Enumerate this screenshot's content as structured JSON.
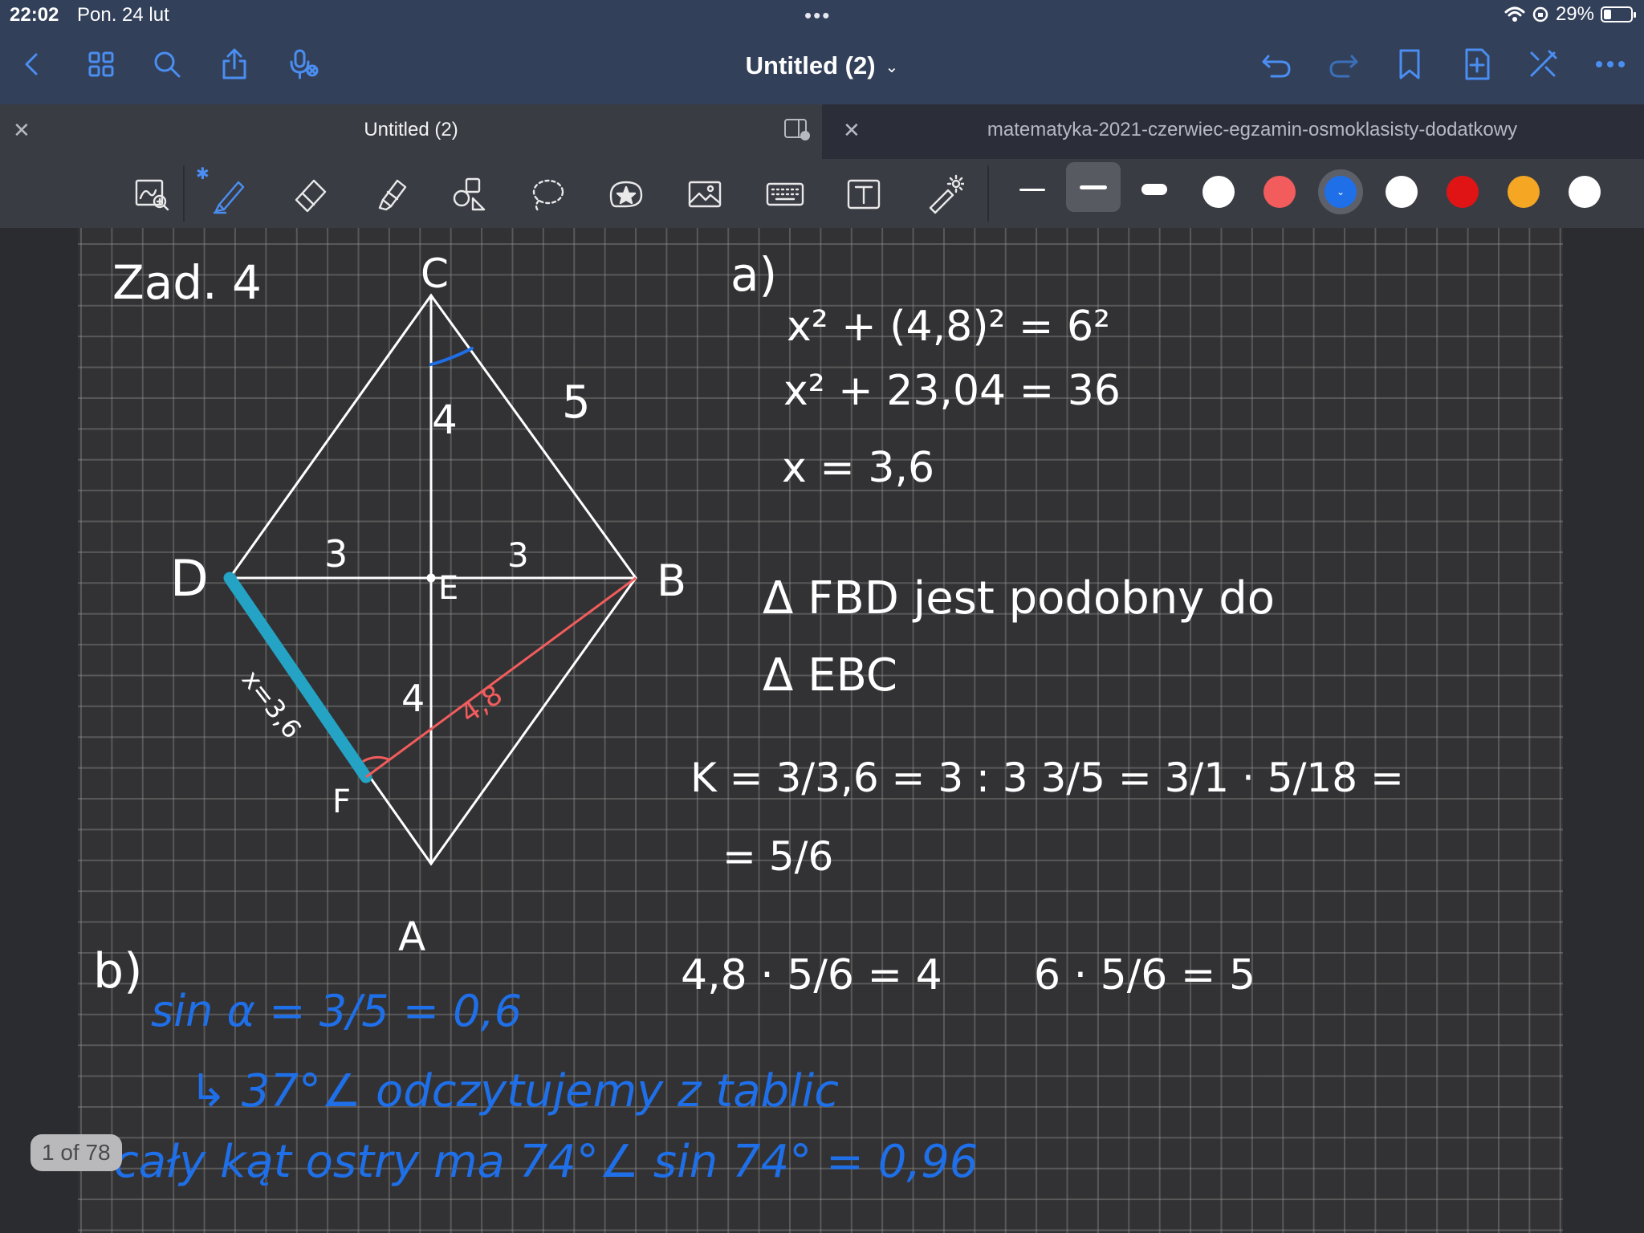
{
  "status_bar": {
    "time": "22:02",
    "date": "Pon. 24 lut",
    "battery_percent": "29%",
    "battery_level": 0.29
  },
  "nav_bar": {
    "title": "Untitled (2)",
    "accent_color": "#4a8ef2"
  },
  "tabs": [
    {
      "label": "Untitled (2)",
      "active": true
    },
    {
      "label": "matematyka-2021-czerwiec-egzamin-osmoklasisty-dodatkowy",
      "active": false
    }
  ],
  "toolbar": {
    "tools": [
      "zoom-lasso",
      "pen",
      "eraser",
      "highlighter",
      "shapes",
      "lasso",
      "stickers",
      "image",
      "keyboard",
      "text",
      "laser-pointer"
    ],
    "selected_tool": "pen",
    "stroke_sizes": [
      "thin",
      "medium",
      "thick"
    ],
    "selected_stroke": "medium",
    "colors": [
      "#ffffff",
      "#f25c5c",
      "#1f6fe8",
      "#ffffff",
      "#e01414",
      "#f5a623",
      "#ffffff"
    ],
    "selected_color": "#1f6fe8"
  },
  "notes": {
    "heading": "Zad. 4",
    "vertices": {
      "C": "C",
      "D": "D",
      "B": "B",
      "A": "A",
      "E": "E",
      "F": "F"
    },
    "lengths": {
      "side": "5",
      "half_vertical_top": "4",
      "half_vertical_bottom": "4",
      "half_horizontal_left": "3",
      "half_horizontal_right": "3",
      "altitude": "4,8",
      "segment_df": "x=3,6"
    },
    "part_a_label": "a)",
    "eq1": "x² + (4,8)² = 6²",
    "eq2": "x² + 23,04 = 36",
    "eq3": "x = 3,6",
    "sim1": "Δ FBD jest podobny do",
    "sim2": "Δ EBC",
    "ratio": "K = 3/3,6 = 3 : 3 3/5 = 3/1 · 5/18 =",
    "ratio2": "= 5/6",
    "calc1": "4,8 · 5/6 = 4",
    "calc2": "6 · 5/6 = 5",
    "part_b_label": "b)",
    "sin": "sin α = 3/5 = 0,6",
    "angle": "↳ 37°∠ odczytujemy z tablic",
    "full": "cały kąt ostry ma 74°∠   sin 74° = 0,96"
  },
  "page_counter": "1 of 78"
}
